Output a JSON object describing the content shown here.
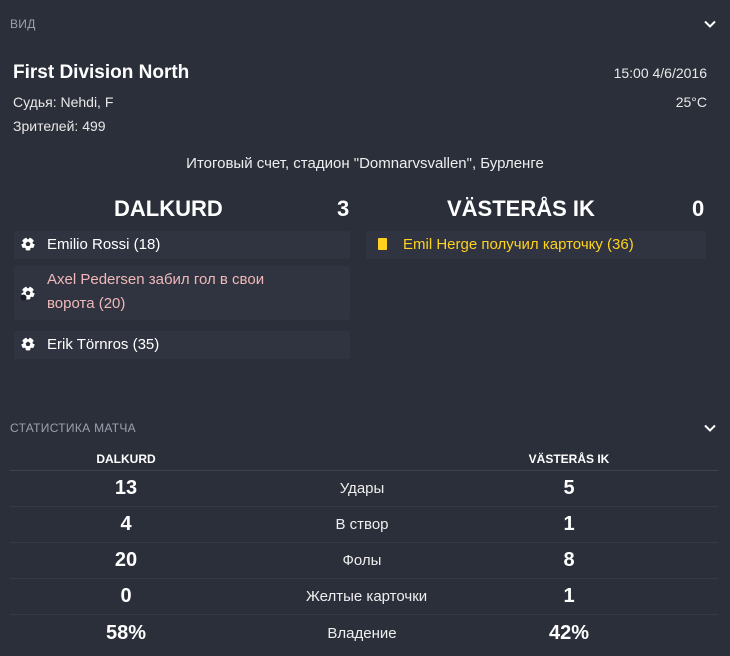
{
  "overview": {
    "section_title": "ВИД",
    "competition": "First Division North",
    "referee": "Судья: Nehdi, F",
    "attendance": "Зрителей: 499",
    "datetime": "15:00 4/6/2016",
    "temperature": "25°C",
    "venue_line": "Итоговый счет, стадион \"Domnarvsvallen\", Бурленге"
  },
  "home": {
    "name": "DALKURD",
    "score": "3",
    "events": [
      {
        "type": "goal",
        "text": "Emilio Rossi (18)"
      },
      {
        "type": "own-goal",
        "text_line1": "Axel Pedersen забил гол в свои",
        "text_line2": "ворота (20)"
      },
      {
        "type": "goal",
        "text": "Erik Törnros (35)"
      }
    ]
  },
  "away": {
    "name": "VÄSTERÅS IK",
    "score": "0",
    "events": [
      {
        "type": "yellow-card",
        "text": "Emil Herge получил карточку (36)"
      }
    ]
  },
  "stats": {
    "section_title": "СТАТИСТИКА МАТЧА",
    "home_header": "DALKURD",
    "away_header": "VÄSTERÅS IK",
    "rows": [
      {
        "label": "Удары",
        "home": "13",
        "away": "5"
      },
      {
        "label": "В створ",
        "home": "4",
        "away": "1"
      },
      {
        "label": "Фолы",
        "home": "20",
        "away": "8"
      },
      {
        "label": "Желтые карточки",
        "home": "0",
        "away": "1"
      },
      {
        "label": "Владение",
        "home": "58%",
        "away": "42%"
      }
    ]
  },
  "colors": {
    "background": "#2b2f3a",
    "own_goal_text": "#f0b8b8",
    "yellow_card": "#ffd21f"
  }
}
